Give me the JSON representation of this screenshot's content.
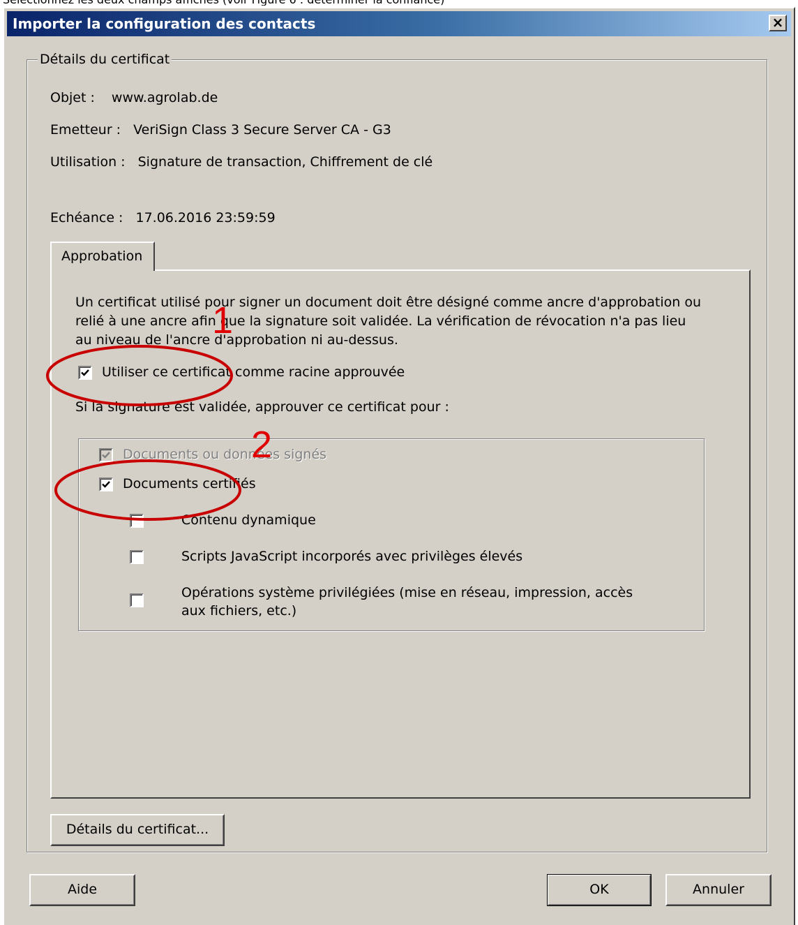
{
  "caption": "Sélectionnez les deux champs affichés (voir Figure 6 : déterminer la confiance)",
  "window": {
    "title": "Importer la configuration des contacts",
    "close_glyph": "×"
  },
  "details": {
    "group_label": "Détails du certificat",
    "subject_label": "Objet :",
    "subject_value": "www.agrolab.de",
    "issuer_label": "Emetteur :",
    "issuer_value": "VeriSign Class 3 Secure Server CA - G3",
    "usage_label": "Utilisation :",
    "usage_value": "Signature de transaction, Chiffrement de clé",
    "expiry_label": "Echéance :",
    "expiry_value": "17.06.2016 23:59:59"
  },
  "tab": {
    "label": "Approbation",
    "description_lines": [
      "Un certificat utilisé pour signer un document doit être désigné comme ancre d'approbation ou",
      "relié à une ancre afin que la signature soit validée. La vérification de révocation n'a pas lieu",
      "au niveau de l'ancre d'approbation ni au-dessus."
    ],
    "trusted_root": {
      "label": "Utiliser ce certificat comme racine approuvée",
      "checked": true
    },
    "trust_for_label": "Si la signature est validée, approuver ce certificat pour :",
    "options": [
      {
        "label": "Documents ou données signés",
        "checked": true,
        "enabled": false
      },
      {
        "label": "Documents certifiés",
        "checked": true,
        "enabled": true
      },
      {
        "label": "Contenu dynamique",
        "checked": false,
        "enabled": true
      },
      {
        "label": "Scripts JavaScript incorporés avec privilèges élevés",
        "checked": false,
        "enabled": true
      },
      {
        "label_lines": [
          "Opérations système privilégiées (mise en réseau, impression, accès",
          "aux fichiers, etc.)"
        ],
        "checked": false,
        "enabled": true
      }
    ]
  },
  "buttons": {
    "certificate_details": "Détails du certificat...",
    "help": "Aide",
    "ok": "OK",
    "cancel": "Annuler"
  },
  "annotations": {
    "marker_1": "1",
    "marker_2": "2",
    "color": "#e00000"
  }
}
